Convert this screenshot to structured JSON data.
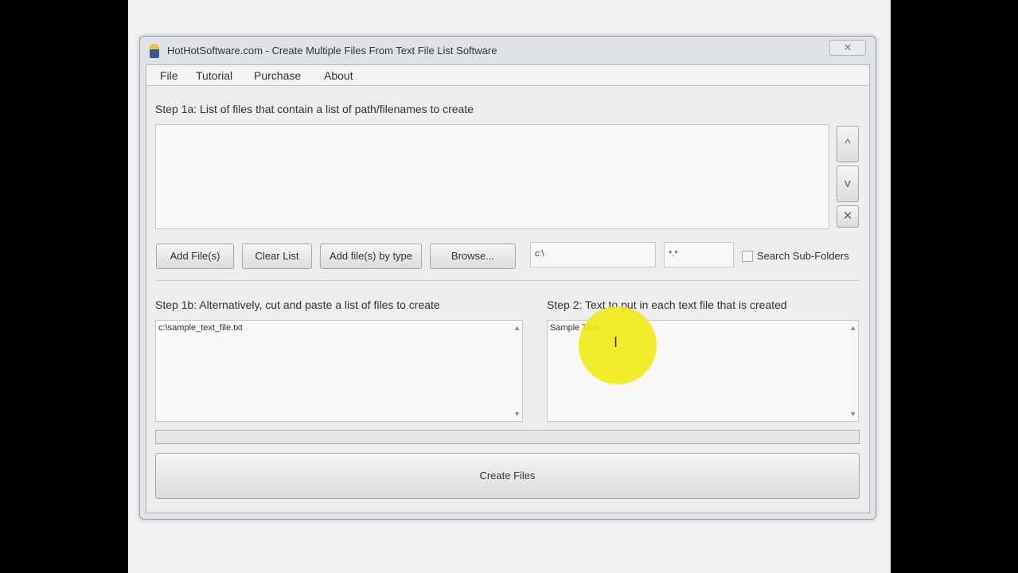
{
  "window": {
    "title": "HotHotSoftware.com - Create Multiple Files From Text File List Software",
    "close": "✕"
  },
  "menu": [
    "File",
    "Tutorial",
    "Purchase",
    "About"
  ],
  "step1a": {
    "label": "Step 1a: List of files that contain a list of path/filenames to create",
    "up": "^",
    "down": "v",
    "remove": "✕"
  },
  "buttons": {
    "add_files": "Add File(s)",
    "clear_list": "Clear List",
    "add_by_type": "Add file(s) by type",
    "browse": "Browse...",
    "create_files": "Create Files"
  },
  "folder_value": "c:\\",
  "pattern_value": "*.*",
  "search_subfolders": "Search Sub-Folders",
  "step1b": {
    "label": "Step 1b: Alternatively, cut and paste a list of files to create",
    "value": "c:\\sample_text_file.txt"
  },
  "step2": {
    "label": "Step 2: Text to put in each text file that is created",
    "value": "Sample Text"
  },
  "progress": 0
}
